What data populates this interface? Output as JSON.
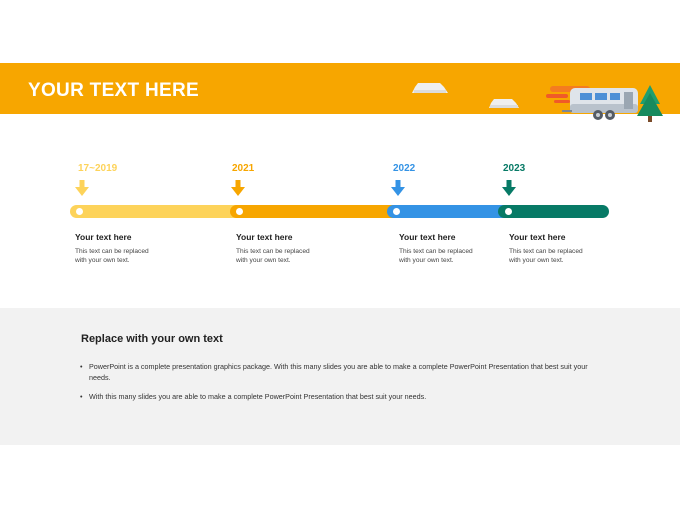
{
  "header": {
    "title": "YOUR TEXT HERE",
    "colors": {
      "banner": "#f7a600",
      "title": "#ffffff"
    }
  },
  "illustrations": [
    "cloud-icon",
    "cloud-icon",
    "camper-trailer-icon",
    "pine-tree-icon"
  ],
  "timeline": {
    "milestones": [
      {
        "year": "17~2019",
        "color": "#fdd35a",
        "title": "Your text here",
        "body": [
          "This text can be replaced",
          "with your own text."
        ]
      },
      {
        "year": "2021",
        "color": "#f7a600",
        "title": "Your text here",
        "body": [
          "This text can be replaced",
          "with your own text."
        ]
      },
      {
        "year": "2022",
        "color": "#3493e5",
        "title": "Your text here",
        "body": [
          "This text can be replaced",
          "with your own text."
        ]
      },
      {
        "year": "2023",
        "color": "#077a66",
        "title": "Your text here",
        "body": [
          "This text can be replaced",
          "with your own text."
        ]
      }
    ]
  },
  "details": {
    "heading": "Replace with your own text",
    "bullets": [
      "PowerPoint is a complete presentation graphics package. With this many slides you are able to make a complete PowerPoint Presentation that best suit your needs.",
      "With this many slides you are able to make a complete PowerPoint Presentation that best suit your needs."
    ]
  }
}
